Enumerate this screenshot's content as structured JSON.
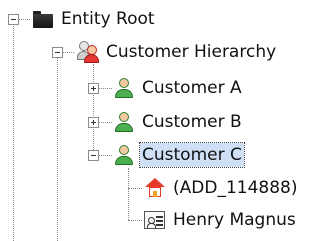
{
  "tree": {
    "root": {
      "label": "Entity Root",
      "icon": "folder-icon",
      "expanded": true,
      "children": [
        {
          "label": "Customer Hierarchy",
          "icon": "customer-group-icon",
          "expanded": true,
          "children": [
            {
              "label": "Customer A",
              "icon": "person-icon",
              "expanded": false
            },
            {
              "label": "Customer B",
              "icon": "person-icon",
              "expanded": false
            },
            {
              "label": "Customer C",
              "icon": "person-icon",
              "expanded": true,
              "selected": true,
              "children": [
                {
                  "label": "(ADD_114888)",
                  "icon": "house-icon"
                },
                {
                  "label": "Henry Magnus",
                  "icon": "contact-card-icon"
                }
              ]
            }
          ]
        }
      ]
    }
  },
  "colors": {
    "selection_background": "#cfe0f6",
    "connector_line": "#8a8a8a",
    "person_green": "#4caf50",
    "house_red": "#e53b2a"
  }
}
